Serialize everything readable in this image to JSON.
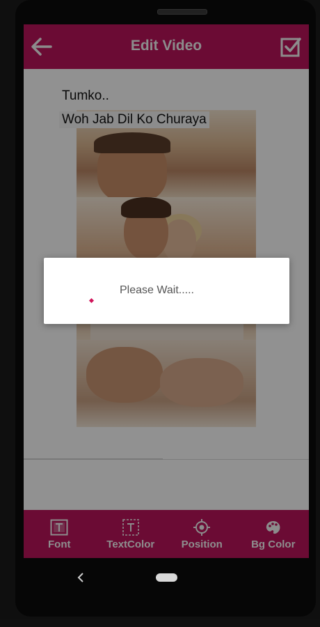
{
  "appbar": {
    "title": "Edit Video",
    "back_icon": "arrow-left-icon",
    "confirm_icon": "checkbox-checked-icon",
    "color": "#b8145a"
  },
  "editor": {
    "text_lines": [
      "Tumko..",
      "Woh Jab Dil Ko Churaya"
    ]
  },
  "toolbar": {
    "items": [
      {
        "label": "Font",
        "icon": "font-box-icon"
      },
      {
        "label": "TextColor",
        "icon": "text-box-icon"
      },
      {
        "label": "Position",
        "icon": "target-icon"
      },
      {
        "label": "Bg Color",
        "icon": "palette-icon"
      }
    ]
  },
  "dialog": {
    "message": "Please Wait.....",
    "accent": "#d0145a"
  },
  "navbar": {
    "back_icon": "nav-back-icon",
    "home_icon": "nav-home-icon"
  }
}
